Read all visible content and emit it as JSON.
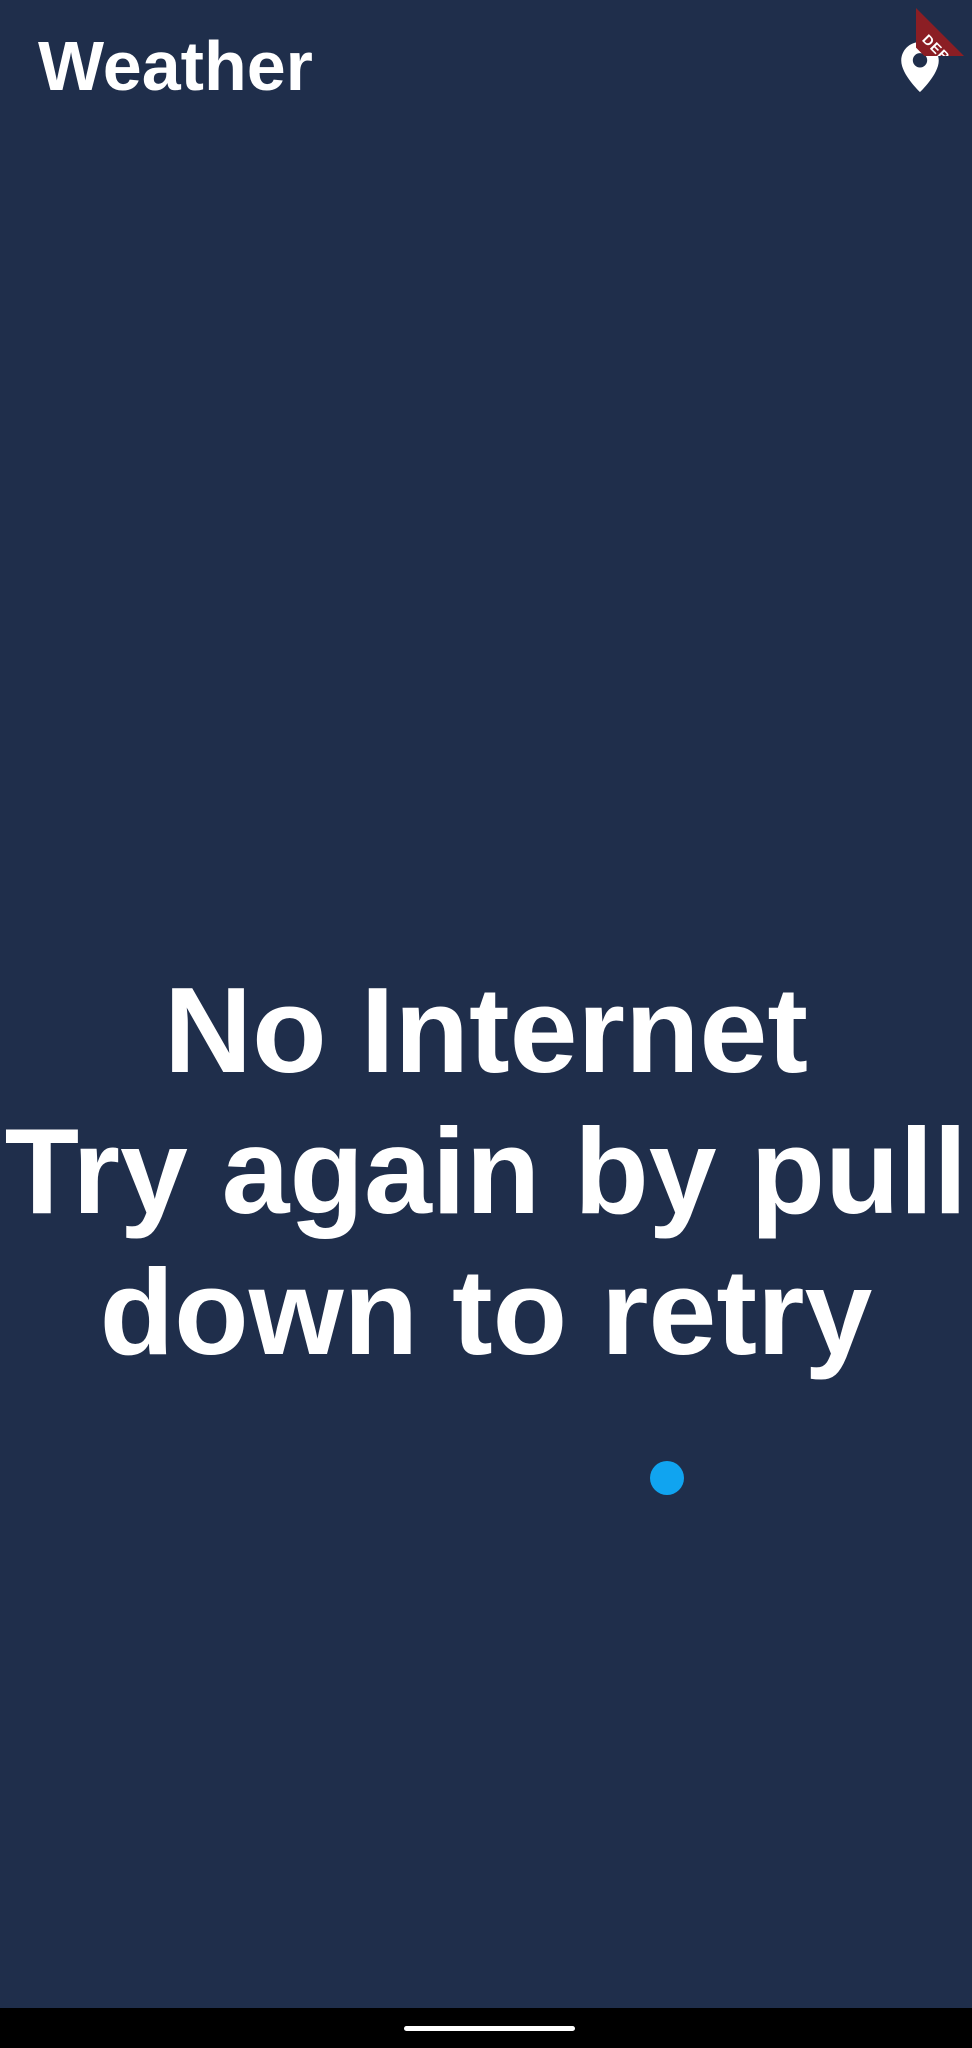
{
  "app_bar": {
    "title": "Weather",
    "action_icon": "location-pin-icon"
  },
  "debug_banner": {
    "label": "DEBUG",
    "color": "#8b1e24"
  },
  "main": {
    "message": "No Internet\n Try again by pull down to retry"
  },
  "refresh_indicator": {
    "color": "#10a4f0"
  },
  "theme": {
    "background": "#1f2e4b",
    "text": "#ffffff",
    "nav_bar": "#000000"
  }
}
